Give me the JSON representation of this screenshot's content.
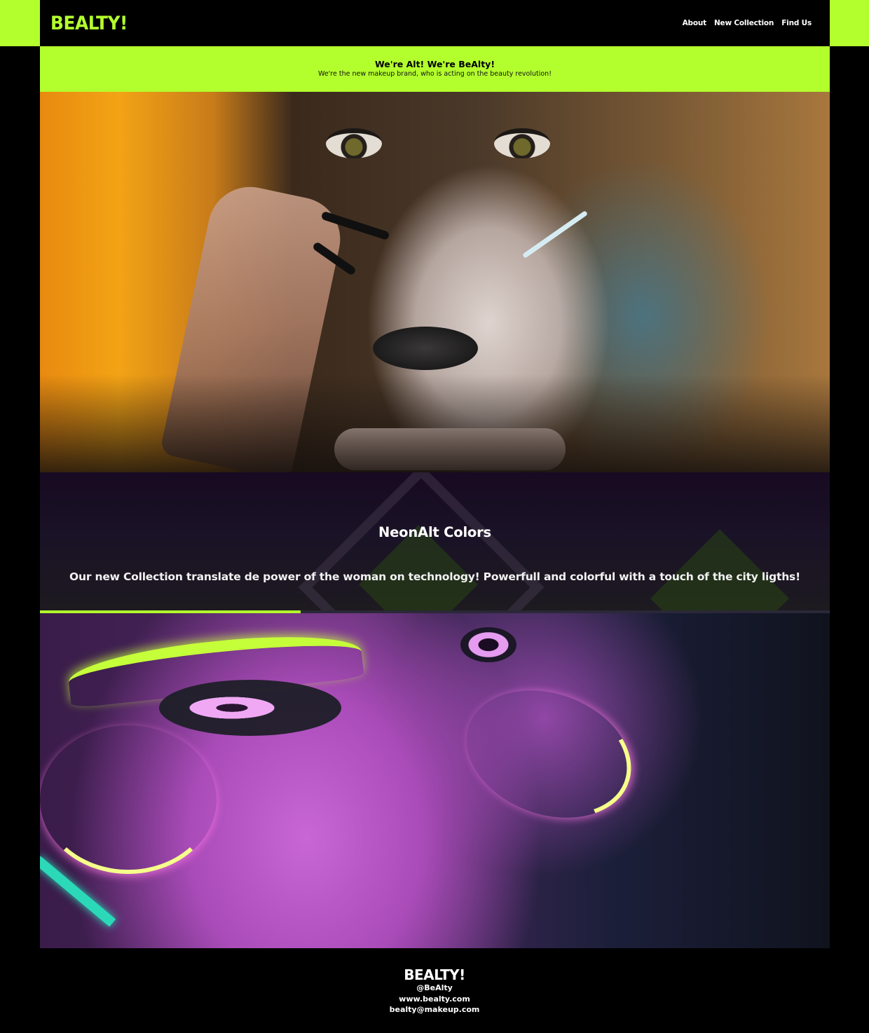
{
  "header": {
    "logo": "BEALTY!",
    "nav": [
      "About",
      "New Collection",
      "Find Us"
    ]
  },
  "banner": {
    "title": "We're Alt! We're BeAlty!",
    "subtitle": "We're the new makeup brand, who is acting on the beauty revolution!"
  },
  "collection": {
    "title": "NeonAlt Colors",
    "description": "Our new Collection translate de power of the woman on technology! Powerfull and colorful with a touch of the city ligths!"
  },
  "carousel": {
    "progress": 0.33
  },
  "footer": {
    "logo": "BEALTY!",
    "handle": "@BeAlty",
    "website": "www.bealty.com",
    "email": "bealty@makeup.com"
  },
  "colors": {
    "accent": "#b3ff2d",
    "background": "#000000",
    "collection_bg": "#170a22"
  }
}
